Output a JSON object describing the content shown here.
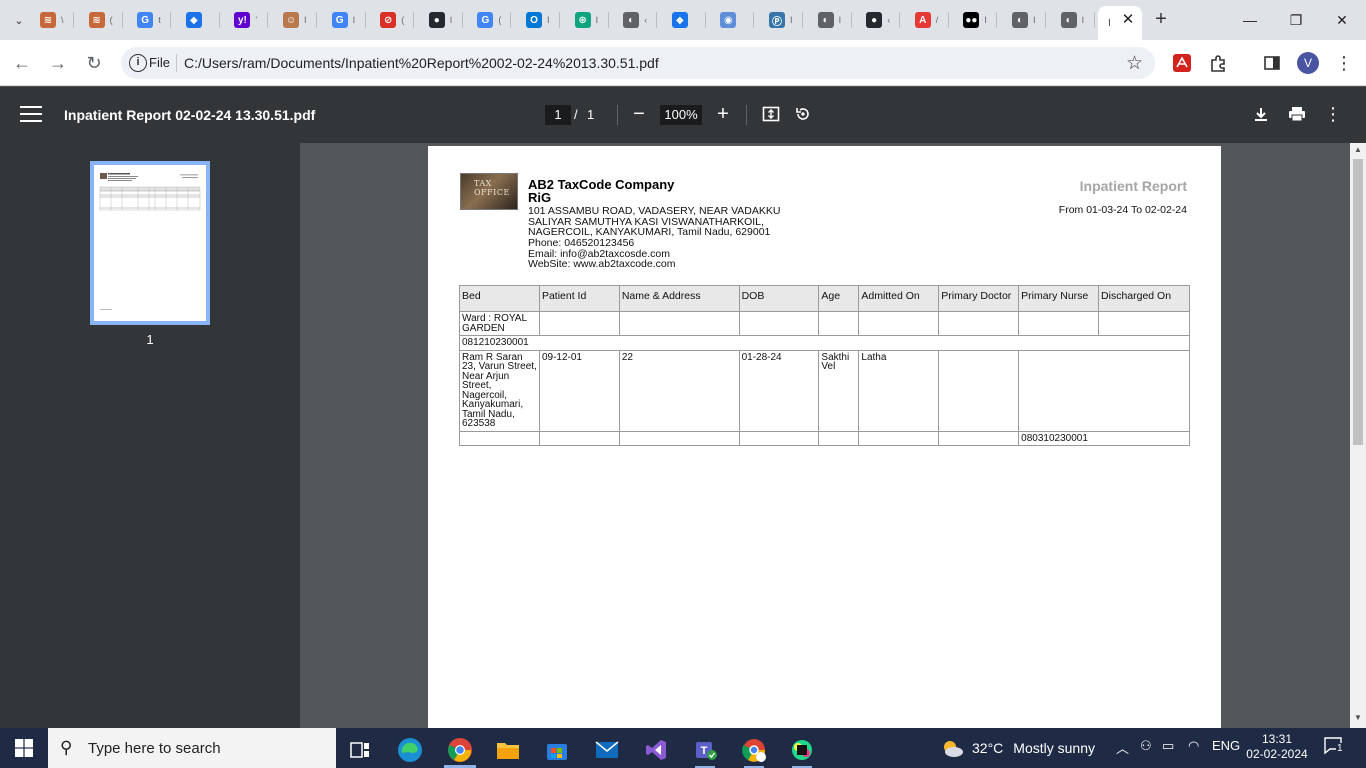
{
  "browser": {
    "tabs": [
      {
        "name": "tab-1",
        "color": "#c7683a",
        "glyph": "≋",
        "title": "\\"
      },
      {
        "name": "tab-2",
        "color": "#c7683a",
        "glyph": "≋",
        "title": "("
      },
      {
        "name": "tab-3",
        "color": "#4285f4",
        "glyph": "G",
        "title": "t"
      },
      {
        "name": "tab-4",
        "color": "#1a73e8",
        "glyph": "◆",
        "title": ""
      },
      {
        "name": "tab-5",
        "color": "#6001d2",
        "glyph": "y!",
        "title": "'"
      },
      {
        "name": "tab-6",
        "color": "#b9794f",
        "glyph": "☺",
        "title": "I"
      },
      {
        "name": "tab-7",
        "color": "#4285f4",
        "glyph": "G",
        "title": "I"
      },
      {
        "name": "tab-8",
        "color": "#d93025",
        "glyph": "⊘",
        "title": "("
      },
      {
        "name": "tab-9",
        "color": "#24292f",
        "glyph": "●",
        "title": "I"
      },
      {
        "name": "tab-10",
        "color": "#4285f4",
        "glyph": "G",
        "title": "("
      },
      {
        "name": "tab-11",
        "color": "#0078d4",
        "glyph": "O",
        "title": "I"
      },
      {
        "name": "tab-12",
        "color": "#10a37f",
        "glyph": "⊛",
        "title": "I"
      },
      {
        "name": "tab-13",
        "color": "#5f6368",
        "glyph": "◐",
        "title": "‹"
      },
      {
        "name": "tab-14",
        "color": "#1a73e8",
        "glyph": "◆",
        "title": ""
      },
      {
        "name": "tab-15",
        "color": "#5f8fd8",
        "glyph": "◉",
        "title": ""
      },
      {
        "name": "tab-16",
        "color": "#3776ab",
        "glyph": "Ⓟ",
        "title": "I"
      },
      {
        "name": "tab-17",
        "color": "#5f6368",
        "glyph": "◐",
        "title": "I"
      },
      {
        "name": "tab-18",
        "color": "#24292f",
        "glyph": "●",
        "title": "‹"
      },
      {
        "name": "tab-19",
        "color": "#e53935",
        "glyph": "A",
        "title": "/"
      },
      {
        "name": "tab-20",
        "color": "#000000",
        "glyph": "●●",
        "title": "I"
      },
      {
        "name": "tab-21",
        "color": "#5f6368",
        "glyph": "◐",
        "title": "I"
      },
      {
        "name": "tab-22",
        "color": "#5f6368",
        "glyph": "◐",
        "title": "I"
      }
    ],
    "active_tab_title": "I",
    "close_glyph": "✕",
    "new_tab": "+",
    "minimize": "—",
    "restore": "❐",
    "close_window": "✕",
    "file_label": "File",
    "url": "C:/Users/ram/Documents/Inpatient%20Report%2002-02-24%2013.30.51.pdf",
    "profile_initial": "V"
  },
  "pdf_viewer": {
    "title": "Inpatient Report 02-02-24 13.30.51.pdf",
    "current_page": "1",
    "page_separator": "/",
    "total_pages": "1",
    "zoom": "100%",
    "thumbnail_label": "1"
  },
  "report": {
    "company_name": "AB2 TaxCode Company",
    "company_sub": "RiG",
    "address_1": "101 ASSAMBU ROAD, VADASERY, NEAR VADAKKU",
    "address_2": "SALIYAR SAMUTHYA KASI VISWANATHARKOIL,",
    "address_3": "NAGERCOIL, KANYAKUMARI, Tamil Nadu, 629001",
    "phone": "Phone: 046520123456",
    "email": "Email: info@ab2taxcosde.com",
    "website": "WebSite: www.ab2taxcode.com",
    "logo_text": "TAX OFFICE",
    "title": "Inpatient Report",
    "date_range": "From 01-03-24 To 02-02-24",
    "columns": [
      "Bed",
      "Patient Id",
      "Name & Address",
      "DOB",
      "Age",
      "Admitted On",
      "Primary Doctor",
      "Primary Nurse",
      "Discharged On"
    ],
    "ward": "Ward : ROYAL GARDEN",
    "group_id": "081210230001",
    "patient": {
      "name_address": "Ram R Saran 23, Varun Street, Near Arjun Street, Nagercoil, Kanyakumari, Tamil Nadu, 623538",
      "patient_id": "09-12-01",
      "name_col": "22",
      "dob": "01-28-24",
      "age": "Sakthi Vel",
      "admitted_on": "Latha"
    },
    "footer_id": "080310230001"
  },
  "taskbar": {
    "search_placeholder": "Type here to search",
    "weather_temp": "32°C",
    "weather_desc": "Mostly sunny",
    "language": "ENG",
    "time": "13:31",
    "date": "02-02-2024",
    "notification_count": "1"
  }
}
